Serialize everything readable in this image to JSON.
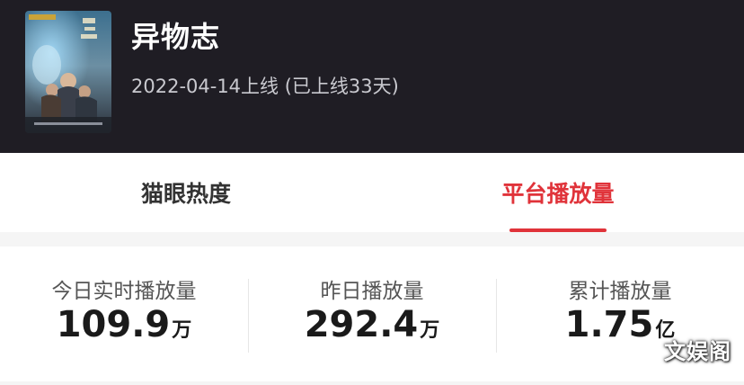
{
  "movie": {
    "title": "异物志",
    "release_info": "2022-04-14上线 (已上线33天)"
  },
  "tabs": [
    {
      "label": "猫眼热度",
      "active": false
    },
    {
      "label": "平台播放量",
      "active": true
    }
  ],
  "stats": [
    {
      "label": "今日实时播放量",
      "value": "109.9",
      "unit": "万"
    },
    {
      "label": "昨日播放量",
      "value": "292.4",
      "unit": "万"
    },
    {
      "label": "累计播放量",
      "value": "1.75",
      "unit": "亿"
    }
  ],
  "watermark": "文娱阁",
  "colors": {
    "header_bg": "#1f1d24",
    "accent": "#e0333a",
    "text_primary": "#1a1a1a"
  }
}
